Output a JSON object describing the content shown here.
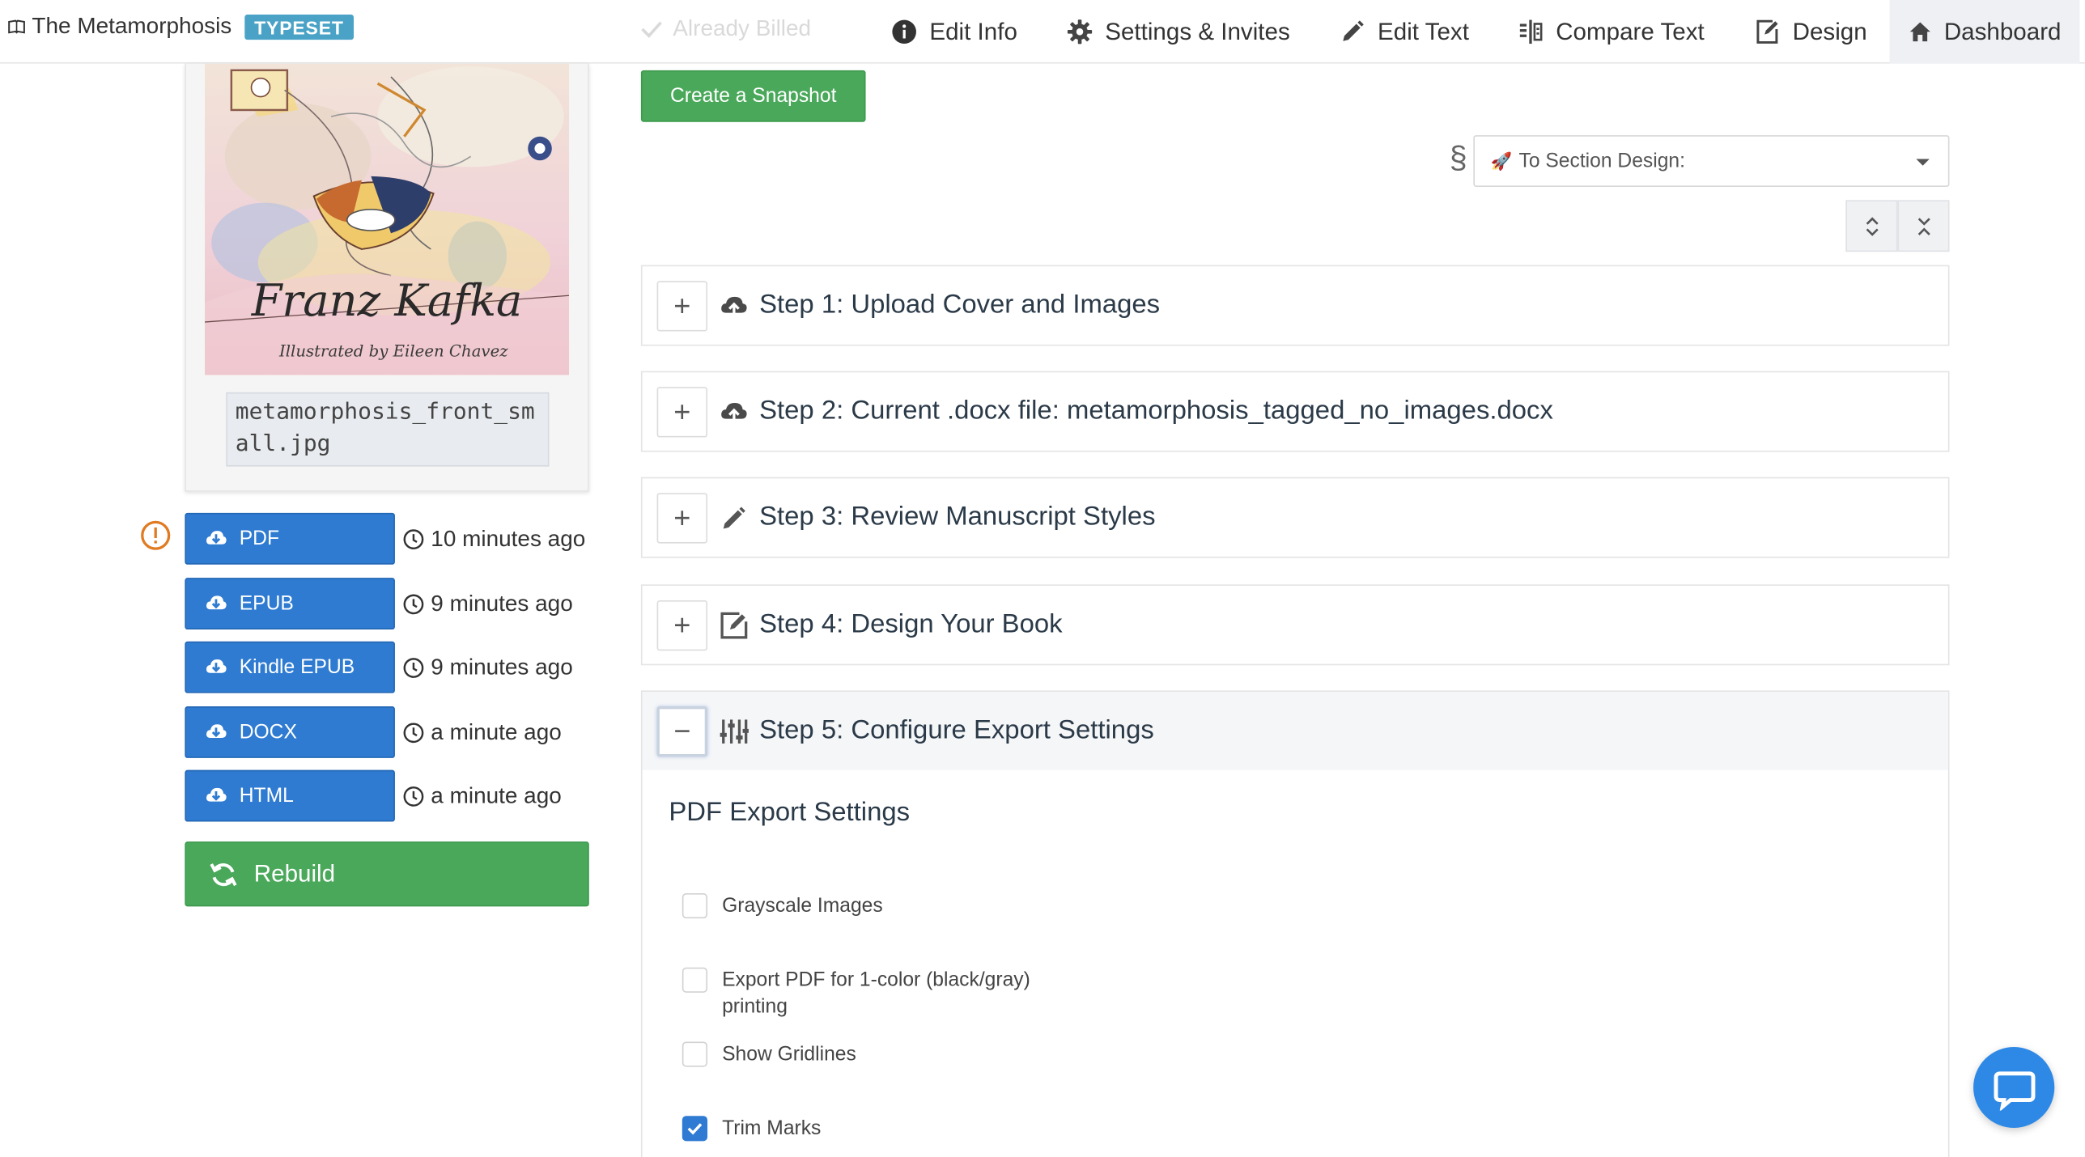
{
  "app": {
    "title": "The Metamorphosis",
    "badge": "TYPESET"
  },
  "nav": {
    "billed": "Already Billed",
    "items": [
      {
        "label": "Edit Info",
        "icon": "info-icon"
      },
      {
        "label": "Settings & Invites",
        "icon": "gear-icon"
      },
      {
        "label": "Edit Text",
        "icon": "pencil-icon"
      },
      {
        "label": "Compare Text",
        "icon": "compare-icon"
      },
      {
        "label": "Design",
        "icon": "edit-square-icon"
      },
      {
        "label": "Dashboard",
        "icon": "home-icon",
        "active": true
      }
    ]
  },
  "cover": {
    "author": "Franz Kafka",
    "illustrator": "Illustrated by Eileen Chavez",
    "filename": "metamorphosis_front_small.jpg"
  },
  "exports": [
    {
      "label": "PDF",
      "time": "10 minutes ago",
      "warning": true
    },
    {
      "label": "EPUB",
      "time": "9 minutes ago"
    },
    {
      "label": "Kindle EPUB",
      "time": "9 minutes ago"
    },
    {
      "label": "DOCX",
      "time": "a minute ago"
    },
    {
      "label": "HTML",
      "time": "a minute ago"
    }
  ],
  "rebuild_label": "Rebuild",
  "snapshot_label": "Create a Snapshot",
  "section_select": {
    "symbol": "§",
    "value": "To Section Design:"
  },
  "steps": [
    {
      "title": "Step 1: Upload Cover and Images",
      "icon": "upload-cloud-icon",
      "toggle": "+"
    },
    {
      "title": "Step 2: Current .docx file: metamorphosis_tagged_no_images.docx",
      "icon": "upload-cloud-icon",
      "toggle": "+"
    },
    {
      "title": "Step 3: Review Manuscript Styles",
      "icon": "pencil-icon",
      "toggle": "+"
    },
    {
      "title": "Step 4: Design Your Book",
      "icon": "edit-square-icon",
      "toggle": "+"
    },
    {
      "title": "Step 5: Configure Export Settings",
      "icon": "sliders-icon",
      "toggle": "−"
    }
  ],
  "pdf_settings": {
    "heading": "PDF Export Settings",
    "options": [
      {
        "label": "Grayscale Images",
        "checked": false
      },
      {
        "label": "Export PDF for 1-color (black/gray) printing",
        "checked": false
      },
      {
        "label": "Show Gridlines",
        "checked": false
      },
      {
        "label": "Trim Marks",
        "checked": true
      }
    ]
  },
  "colors": {
    "primary_blue": "#2e7bd1",
    "success_green": "#4aa85a",
    "badge_blue": "#4aa3c7",
    "warning_orange": "#e07b24",
    "chat_blue": "#2e89e6"
  }
}
